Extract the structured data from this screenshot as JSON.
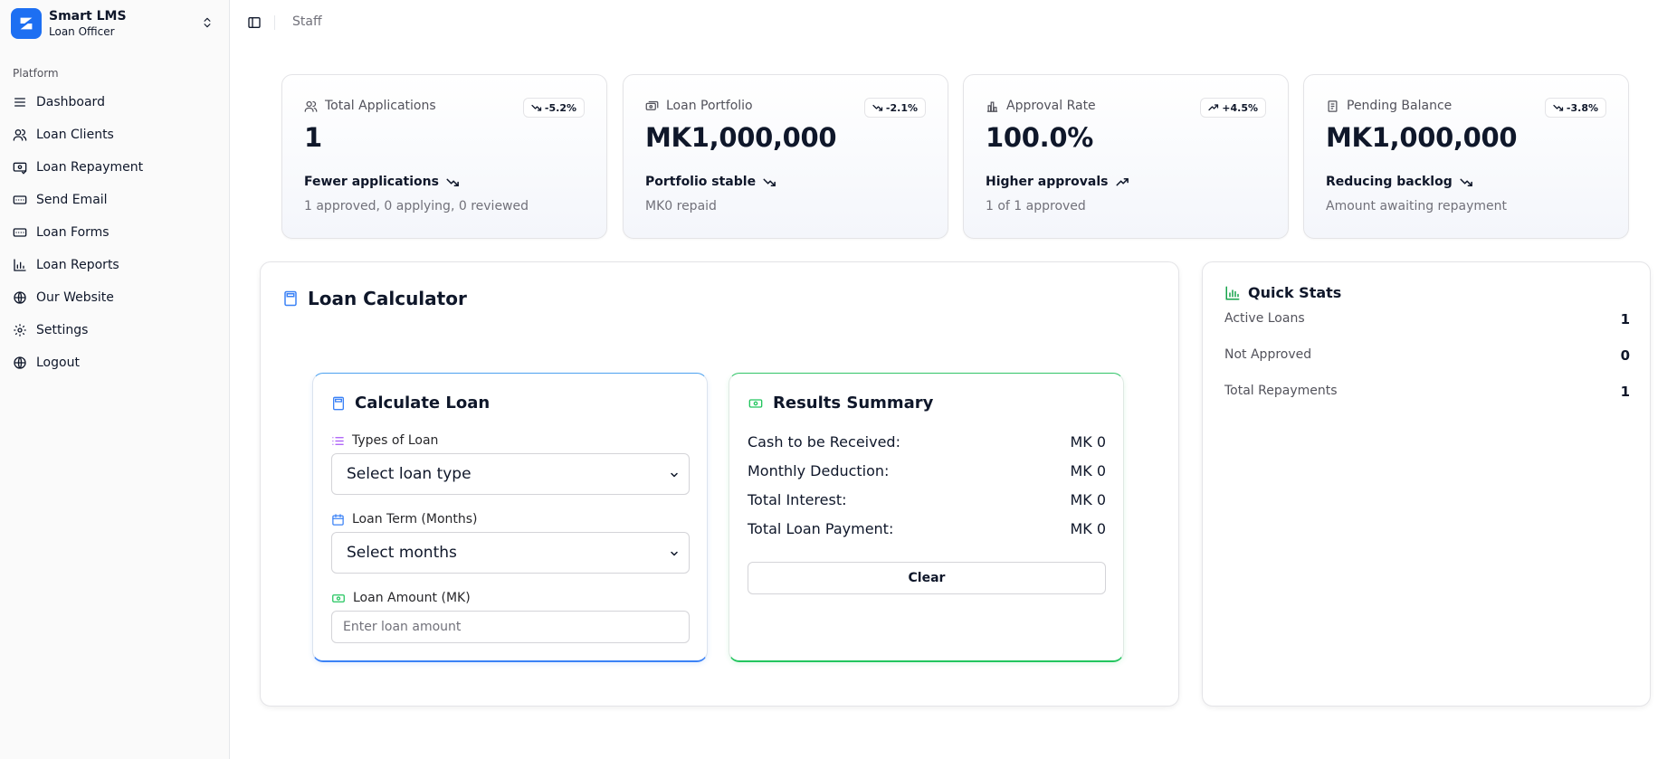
{
  "brand": {
    "title": "Smart LMS",
    "subtitle": "Loan Officer"
  },
  "sidebar": {
    "group_label": "Platform",
    "items": [
      {
        "label": "Dashboard",
        "icon": "menu-icon"
      },
      {
        "label": "Loan Clients",
        "icon": "users-icon"
      },
      {
        "label": "Loan Repayment",
        "icon": "repayment-icon"
      },
      {
        "label": "Send Email",
        "icon": "form-icon"
      },
      {
        "label": "Loan Forms",
        "icon": "form-icon"
      },
      {
        "label": "Loan Reports",
        "icon": "bar-chart-icon"
      },
      {
        "label": "Our Website",
        "icon": "globe-icon"
      },
      {
        "label": "Settings",
        "icon": "gear-icon"
      },
      {
        "label": "Logout",
        "icon": "globe-icon"
      }
    ]
  },
  "header": {
    "breadcrumb": "Staff"
  },
  "stats": [
    {
      "label": "Total Applications",
      "value": "1",
      "badge": "-5.2%",
      "trend": "down",
      "footer": "Fewer applications",
      "description": "1 approved, 0 applying, 0 reviewed",
      "icon": "users-icon"
    },
    {
      "label": "Loan Portfolio",
      "value": "MK1,000,000",
      "badge": "-2.1%",
      "trend": "down",
      "footer": "Portfolio stable",
      "description": "MK0 repaid",
      "icon": "wallet-icon"
    },
    {
      "label": "Approval Rate",
      "value": "100.0%",
      "badge": "+4.5%",
      "trend": "up",
      "footer": "Higher approvals",
      "description": "1 of 1 approved",
      "icon": "bar-chart-icon"
    },
    {
      "label": "Pending Balance",
      "value": "MK1,000,000",
      "badge": "-3.8%",
      "trend": "down",
      "footer": "Reducing backlog",
      "description": "Amount awaiting repayment",
      "icon": "receipt-icon"
    }
  ],
  "calculator": {
    "title": "Loan Calculator",
    "form": {
      "title": "Calculate Loan",
      "loan_type_label": "Types of Loan",
      "loan_type_value": "Select loan type",
      "term_label": "Loan Term (Months)",
      "term_value": "Select months",
      "amount_label": "Loan Amount (MK)",
      "amount_placeholder": "Enter loan amount"
    },
    "results": {
      "title": "Results Summary",
      "rows": [
        {
          "label": "Cash to be Received:",
          "value": "MK 0"
        },
        {
          "label": "Monthly Deduction:",
          "value": "MK 0"
        },
        {
          "label": "Total Interest:",
          "value": "MK 0"
        },
        {
          "label": "Total Loan Payment:",
          "value": "MK 0"
        }
      ],
      "clear_label": "Clear"
    }
  },
  "quick_stats": {
    "title": "Quick Stats",
    "rows": [
      {
        "label": "Active Loans",
        "value": "1"
      },
      {
        "label": "Not Approved",
        "value": "0"
      },
      {
        "label": "Total Repayments",
        "value": "1"
      }
    ]
  },
  "colors": {
    "brand": "#1d6ff2",
    "calc_accent": "#3b82f6",
    "results_accent": "#22c55e",
    "quick_accent": "#16a34a",
    "list_icon": "#a855f7"
  }
}
